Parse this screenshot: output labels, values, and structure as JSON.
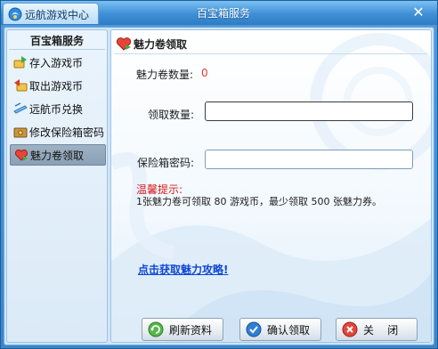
{
  "app": {
    "tab_title": "远航游戏中心",
    "window_title": "百宝箱服务",
    "close_glyph": "✕"
  },
  "sidebar": {
    "header": "百宝箱服务",
    "items": [
      {
        "label": "存入游戏币",
        "icon": "deposit-icon"
      },
      {
        "label": "取出游戏币",
        "icon": "withdraw-icon"
      },
      {
        "label": "远航币兑换",
        "icon": "exchange-icon"
      },
      {
        "label": "修改保险箱密码",
        "icon": "safe-password-icon"
      },
      {
        "label": "魅力卷领取",
        "icon": "charm-coupon-icon",
        "active": true
      }
    ]
  },
  "panel": {
    "title": "魅力卷领取",
    "charm_count_label": "魅力卷数量:",
    "charm_count_value": "0",
    "claim_amount_label": "领取数量:",
    "claim_amount_value": "",
    "safe_password_label": "保险箱密码:",
    "safe_password_value": "",
    "hint_title": "温馨提示:",
    "hint_text": "1张魅力卷可领取 80 游戏币，最少领取 500 张魅力券。",
    "link_text": "点击获取魅力攻略!"
  },
  "buttons": {
    "refresh": "刷新资料",
    "confirm": "确认领取",
    "close": "关    闭"
  },
  "colors": {
    "accent": "#3a86cc",
    "warning": "#d61c1c",
    "link": "#0f47d6",
    "value": "#e23b2b"
  }
}
